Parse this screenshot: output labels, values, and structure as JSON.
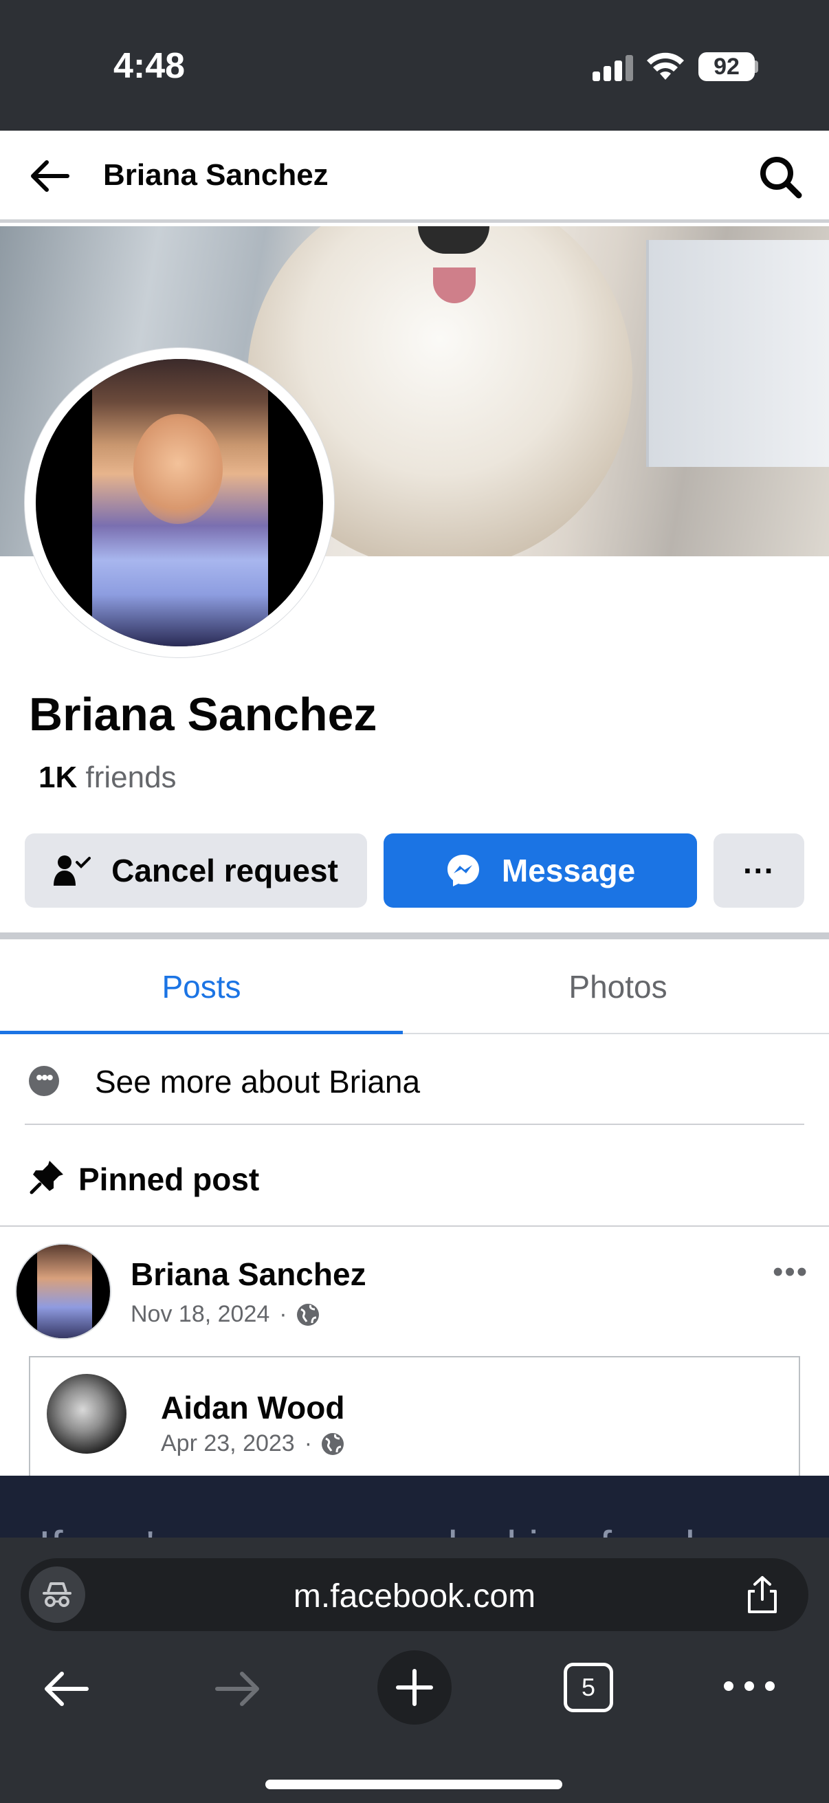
{
  "status_bar": {
    "time": "4:48",
    "battery": "92"
  },
  "header": {
    "title": "Briana Sanchez"
  },
  "profile": {
    "name": "Briana Sanchez",
    "friends_count": "1K",
    "friends_label": "friends"
  },
  "actions": {
    "cancel_request": "Cancel request",
    "message": "Message",
    "more": "···"
  },
  "tabs": [
    {
      "label": "Posts",
      "active": true
    },
    {
      "label": "Photos",
      "active": false
    }
  ],
  "about": {
    "see_more": "See more about Briana"
  },
  "pinned": {
    "label": "Pinned post"
  },
  "post": {
    "author": "Briana Sanchez",
    "date": "Nov 18, 2024",
    "separator": "·",
    "more": "•••",
    "shared": {
      "author": "Aidan Wood",
      "date": "Apr 23, 2023"
    },
    "text_partial": "If you're on my page looking for clues"
  },
  "browser": {
    "url": "m.facebook.com",
    "tab_count": "5"
  },
  "colors": {
    "accent": "#1b74e4",
    "status_bar_bg": "#2d3035",
    "button_gray": "#e4e6eb",
    "text_secondary": "#65676b"
  }
}
